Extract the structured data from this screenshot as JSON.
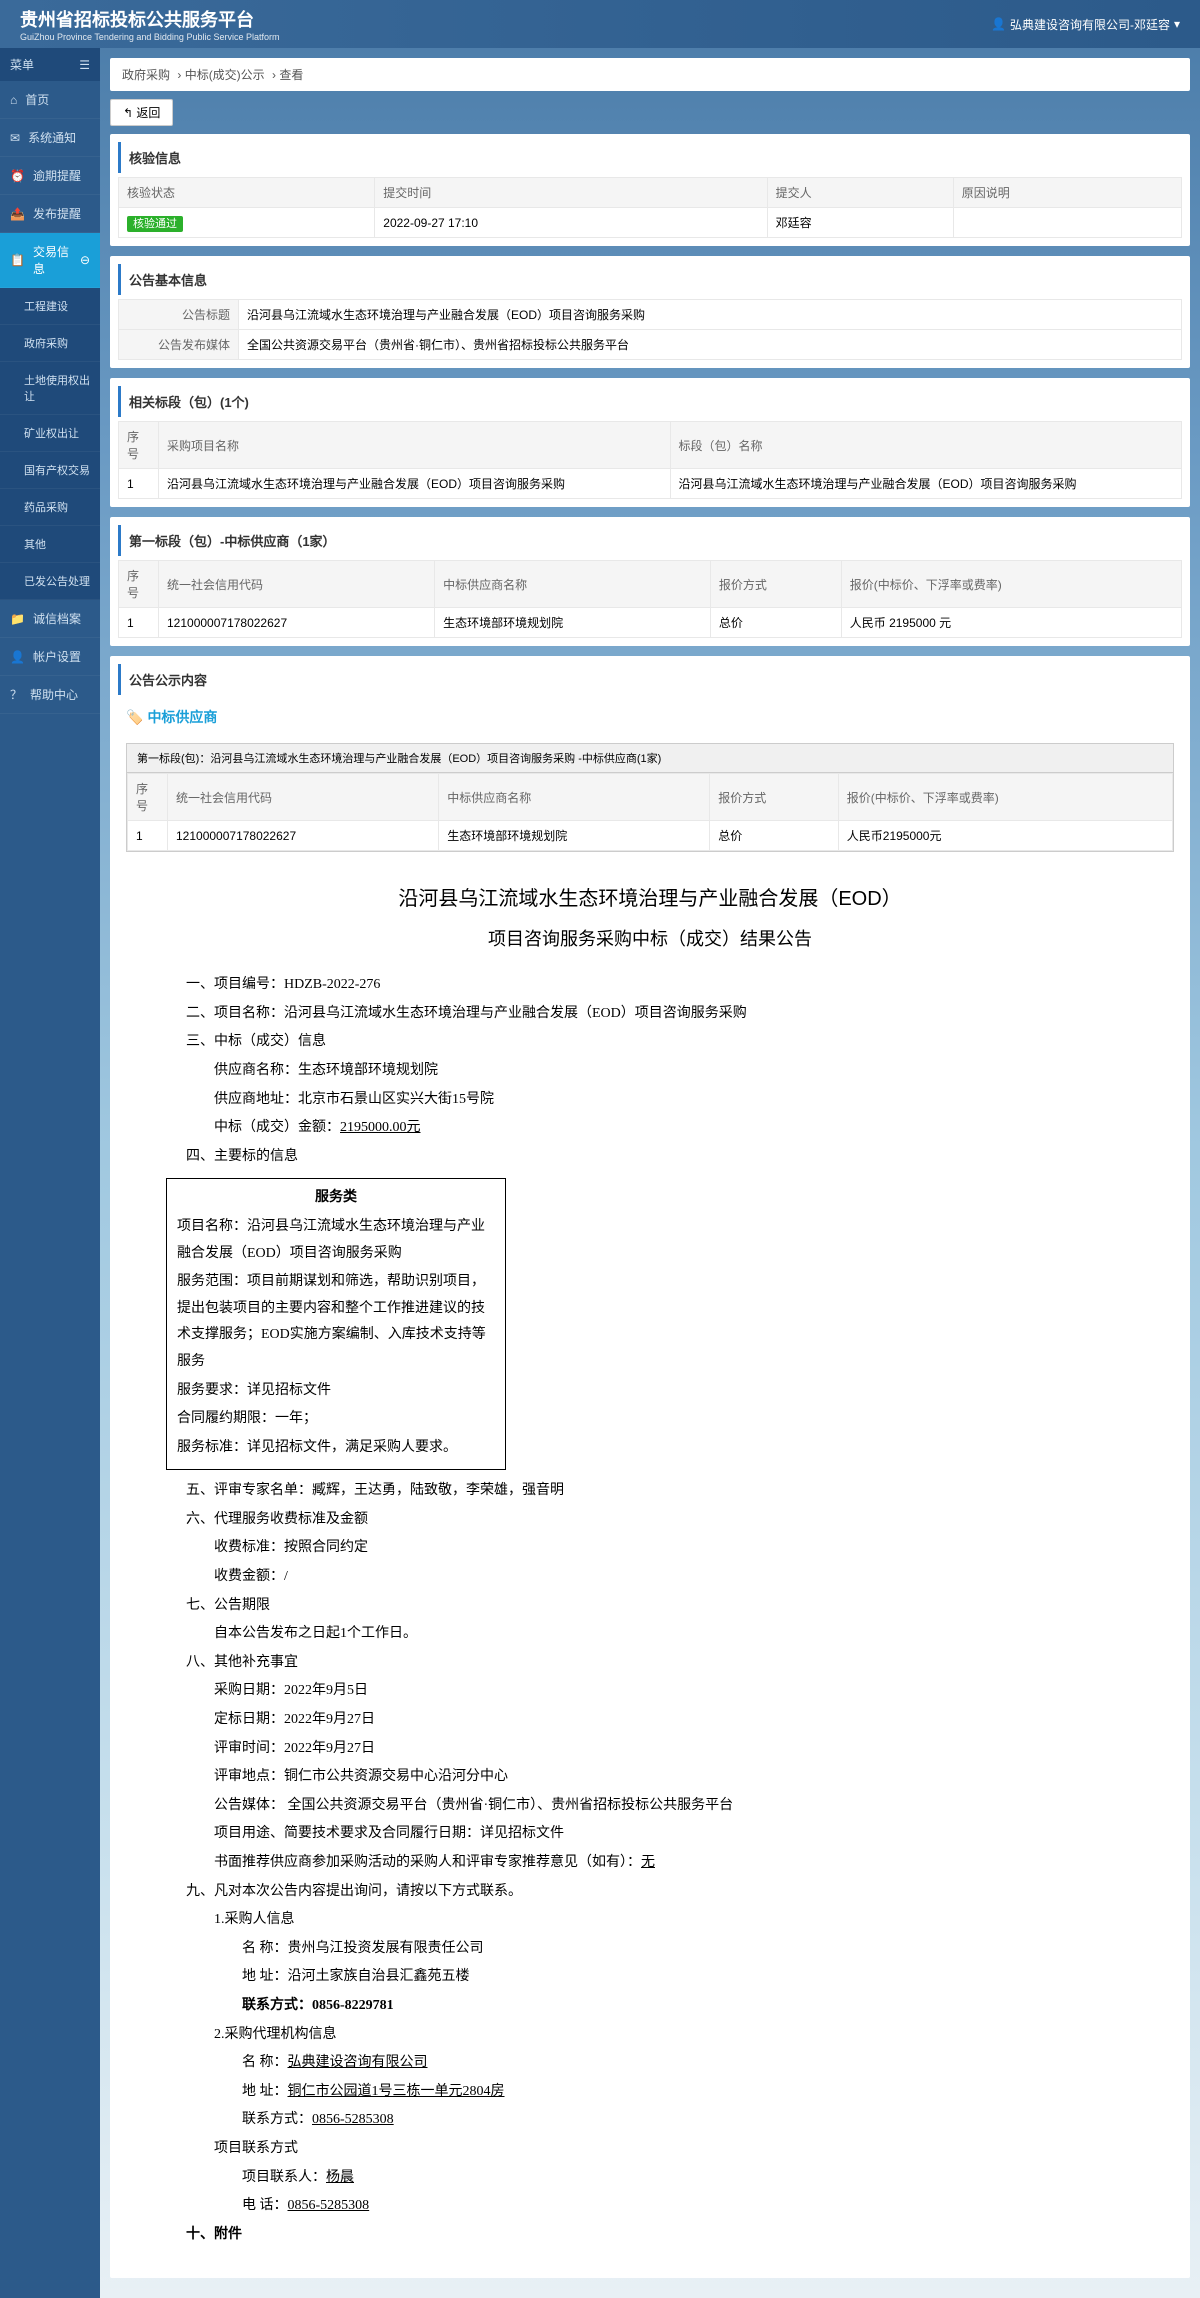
{
  "header": {
    "title": "贵州省招标投标公共服务平台",
    "subtitle": "GuiZhou Province Tendering and Bidding Public Service Platform",
    "user": "弘典建设咨询有限公司-邓廷容"
  },
  "sidebar": {
    "menu_label": "菜单",
    "items": [
      {
        "icon": "home",
        "label": "首页"
      },
      {
        "icon": "mail",
        "label": "系统通知"
      },
      {
        "icon": "clock",
        "label": "逾期提醒"
      },
      {
        "icon": "publish",
        "label": "发布提醒"
      },
      {
        "icon": "trade",
        "label": "交易信息",
        "active": true,
        "expand": true
      },
      {
        "icon": "file",
        "label": "诚信档案"
      },
      {
        "icon": "user",
        "label": "帐户设置"
      },
      {
        "icon": "help",
        "label": "帮助中心"
      }
    ],
    "subitems": [
      "工程建设",
      "政府采购",
      "土地使用权出让",
      "矿业权出让",
      "国有产权交易",
      "药品采购",
      "其他",
      "已发公告处理"
    ]
  },
  "breadcrumb": [
    "政府采购",
    "中标(成交)公示",
    "查看"
  ],
  "back_btn": "↰ 返回",
  "panels": {
    "verify": {
      "title": "核验信息",
      "headers": [
        "核验状态",
        "提交时间",
        "提交人",
        "原因说明"
      ],
      "status": "核验通过",
      "time": "2022-09-27 17:10",
      "person": "邓廷容",
      "reason": ""
    },
    "basic": {
      "title": "公告基本信息",
      "rows": [
        {
          "label": "公告标题",
          "value": "沿河县乌江流域水生态环境治理与产业融合发展（EOD）项目咨询服务采购"
        },
        {
          "label": "公告发布媒体",
          "value": "全国公共资源交易平台（贵州省·铜仁市）、贵州省招标投标公共服务平台"
        }
      ]
    },
    "related": {
      "title": "相关标段（包）(1个)",
      "headers": [
        "序号",
        "采购项目名称",
        "标段（包）名称"
      ],
      "rows": [
        {
          "no": "1",
          "name": "沿河县乌江流域水生态环境治理与产业融合发展（EOD）项目咨询服务采购",
          "section": "沿河县乌江流域水生态环境治理与产业融合发展（EOD）项目咨询服务采购"
        }
      ]
    },
    "supplier": {
      "title": "第一标段（包）-中标供应商（1家）",
      "headers": [
        "序号",
        "统一社会信用代码",
        "中标供应商名称",
        "报价方式",
        "报价(中标价、下浮率或费率)"
      ],
      "rows": [
        {
          "no": "1",
          "code": "121000007178022627",
          "name": "生态环境部环境规划院",
          "method": "总价",
          "price": "人民币 2195000 元"
        }
      ]
    },
    "content": {
      "title": "公告公示内容",
      "supplier_badge": "中标供应商",
      "nested_title": "第一标段(包)：沿河县乌江流域水生态环境治理与产业融合发展（EOD）项目咨询服务采购 -中标供应商(1家)",
      "nested_headers": [
        "序号",
        "统一社会信用代码",
        "中标供应商名称",
        "报价方式",
        "报价(中标价、下浮率或费率)"
      ],
      "nested_row": {
        "no": "1",
        "code": "121000007178022627",
        "name": "生态环境部环境规划院",
        "method": "总价",
        "price": "人民币2195000元"
      }
    }
  },
  "doc": {
    "title": "沿河县乌江流域水生态环境治理与产业融合发展（EOD）",
    "subtitle": "项目咨询服务采购中标（成交）结果公告",
    "l1": "一、项目编号：HDZB-2022-276",
    "l2": "二、项目名称：沿河县乌江流域水生态环境治理与产业融合发展（EOD）项目咨询服务采购",
    "l3": "三、中标（成交）信息",
    "l3a": "供应商名称：生态环境部环境规划院",
    "l3b": "供应商地址：北京市石景山区实兴大街15号院",
    "l3c": "中标（成交）金额：",
    "l3c_amt": "2195000.00元",
    "l4": "四、主要标的信息",
    "box_title": "服务类",
    "box1": "项目名称：沿河县乌江流域水生态环境治理与产业融合发展（EOD）项目咨询服务采购",
    "box2": "服务范围：项目前期谋划和筛选，帮助识别项目，提出包装项目的主要内容和整个工作推进建议的技术支撑服务；EOD实施方案编制、入库技术支持等服务",
    "box3": "服务要求：详见招标文件",
    "box4": "合同履约期限：一年；",
    "box5": "服务标准：详见招标文件，满足采购人要求。",
    "l5": "五、评审专家名单：臧辉，王达勇，陆致敬，李荣雄，强音明",
    "l6": "六、代理服务收费标准及金额",
    "l6a": "收费标准：按照合同约定",
    "l6b": "收费金额：/",
    "l7": "七、公告期限",
    "l7a": "自本公告发布之日起1个工作日。",
    "l8": "八、其他补充事宜",
    "l8a": "采购日期：2022年9月5日",
    "l8b": "定标日期：2022年9月27日",
    "l8c": "评审时间：2022年9月27日",
    "l8d": "评审地点：铜仁市公共资源交易中心沿河分中心",
    "l8e": "公告媒体：  全国公共资源交易平台（贵州省·铜仁市）、贵州省招标投标公共服务平台",
    "l8f": "项目用途、简要技术要求及合同履行日期：详见招标文件",
    "l8g": "书面推荐供应商参加采购活动的采购人和评审专家推荐意见（如有）：",
    "l8g_u": "无",
    "l9": "九、凡对本次公告内容提出询问，请按以下方式联系。",
    "l9_1": "1.采购人信息",
    "l9_1a": "名      称：贵州乌江投资发展有限责任公司",
    "l9_1b": "地      址：沿河土家族自治县汇鑫苑五楼",
    "l9_1c": "联系方式：0856-8229781",
    "l9_2": "2.采购代理机构信息",
    "l9_2a": "名      称：",
    "l9_2a_u": "弘典建设咨询有限公司",
    "l9_2b": "地      址：",
    "l9_2b_u": "铜仁市公园道1号三栋一单元2804房",
    "l9_2c": "联系方式：",
    "l9_2c_u": "0856-5285308",
    "l9_3": "项目联系方式",
    "l9_3a": "项目联系人：",
    "l9_3a_u": "杨晨",
    "l9_3b": "电      话：",
    "l9_3b_u": "0856-5285308",
    "l10": "十、附件"
  }
}
